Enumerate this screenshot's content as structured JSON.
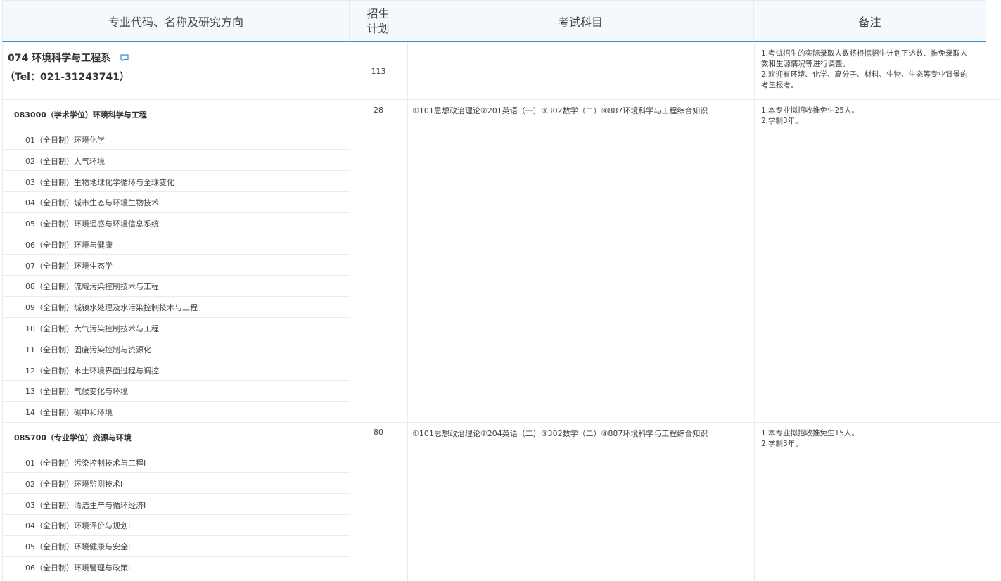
{
  "header": {
    "col1": "专业代码、名称及研究方向",
    "col2_line1": "招生",
    "col2_line2": "计划",
    "col3": "考试科目",
    "col4": "备注"
  },
  "department": {
    "title": "074 环境科学与工程系",
    "tel": "（Tel：021-31243741）",
    "plan": "113",
    "notes": [
      "1.考试招生的实际录取人数将根据招生计划下达数、推免录取人",
      "数和生源情况等进行调整。",
      "2.欢迎有环境、化学、高分子、材料、生物、生态等专业背景的",
      "考生报考。"
    ]
  },
  "majors": [
    {
      "name": "083000（学术学位）环境科学与工程",
      "plan": "28",
      "subjects": "①101思想政治理论②201英语（一）③302数学（二）④887环境科学与工程综合知识",
      "notes": [
        "1.本专业拟招收推免生25人。",
        "2.学制3年。"
      ],
      "directions": [
        "01（全日制）环境化学",
        "02（全日制）大气环境",
        "03（全日制）生物地球化学循环与全球变化",
        "04（全日制）城市生态与环境生物技术",
        "05（全日制）环境遥感与环境信息系统",
        "06（全日制）环境与健康",
        "07（全日制）环境生态学",
        "08（全日制）流域污染控制技术与工程",
        "09（全日制）城镇水处理及水污染控制技术与工程",
        "10（全日制）大气污染控制技术与工程",
        "11（全日制）固废污染控制与资源化",
        "12（全日制）水土环境界面过程与调控",
        "13（全日制）气候变化与环境",
        "14（全日制）碳中和环境"
      ]
    },
    {
      "name": "085700（专业学位）资源与环境",
      "plan": "80",
      "subjects": "①101思想政治理论②204英语（二）③302数学（二）④887环境科学与工程综合知识",
      "notes": [
        "1.本专业拟招收推免生15人。",
        "2.学制3年。"
      ],
      "directions": [
        "01（全日制）污染控制技术与工程Ⅰ",
        "02（全日制）环境监测技术Ⅰ",
        "03（全日制）清洁生产与循环经济Ⅰ",
        "04（全日制）环境评价与规划Ⅰ",
        "05（全日制）环境健康与安全Ⅰ",
        "06（全日制）环境管理与政策Ⅰ"
      ]
    }
  ],
  "colors": {
    "accent": "#2f8fd6",
    "header_bg": "#f5f8fc",
    "grid": "#e8ebef"
  }
}
